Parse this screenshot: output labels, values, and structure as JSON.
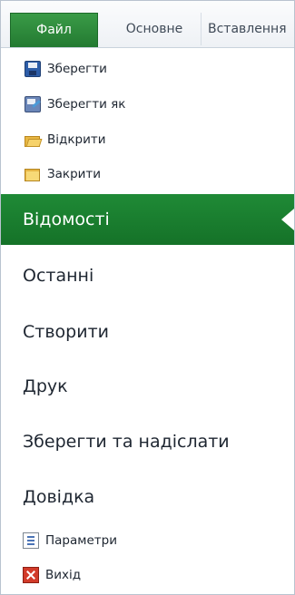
{
  "ribbon": {
    "tabs": [
      {
        "label": "Файл"
      },
      {
        "label": "Основне"
      },
      {
        "label": "Вставлення"
      }
    ]
  },
  "quick_commands": [
    {
      "label": "Зберегти",
      "icon": "save-icon"
    },
    {
      "label": "Зберегти як",
      "icon": "save-as-icon"
    },
    {
      "label": "Відкрити",
      "icon": "open-folder-icon"
    },
    {
      "label": "Закрити",
      "icon": "close-folder-icon"
    }
  ],
  "backstage": {
    "selected": {
      "label": "Відомості"
    },
    "items": [
      {
        "label": "Останні"
      },
      {
        "label": "Створити"
      },
      {
        "label": "Друк"
      },
      {
        "label": "Зберегти та надіслати"
      },
      {
        "label": "Довідка"
      }
    ]
  },
  "bottom_commands": [
    {
      "label": "Параметри",
      "icon": "options-icon"
    },
    {
      "label": "Вихід",
      "icon": "exit-icon"
    }
  ],
  "colors": {
    "accent_green": "#1f8a36",
    "text": "#1e2631"
  }
}
